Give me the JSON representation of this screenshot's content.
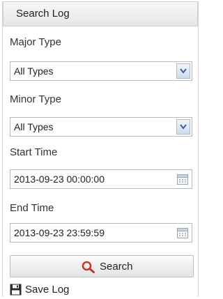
{
  "panel": {
    "title": "Search Log"
  },
  "major_type": {
    "label": "Major Type",
    "selected": "All Types"
  },
  "minor_type": {
    "label": "Minor Type",
    "selected": "All Types"
  },
  "start_time": {
    "label": "Start Time",
    "value": "2013-09-23 00:00:00"
  },
  "end_time": {
    "label": "End Time",
    "value": "2013-09-23 23:59:59"
  },
  "buttons": {
    "search_label": "Search",
    "save_log_label": "Save Log"
  },
  "icons": {
    "dropdown": "chevron-down-icon",
    "calendar": "calendar-icon",
    "search": "search-icon",
    "save": "save-icon"
  },
  "colors": {
    "search_icon": "#c0392b",
    "dropdown_arrow": "#3a5f9e"
  }
}
